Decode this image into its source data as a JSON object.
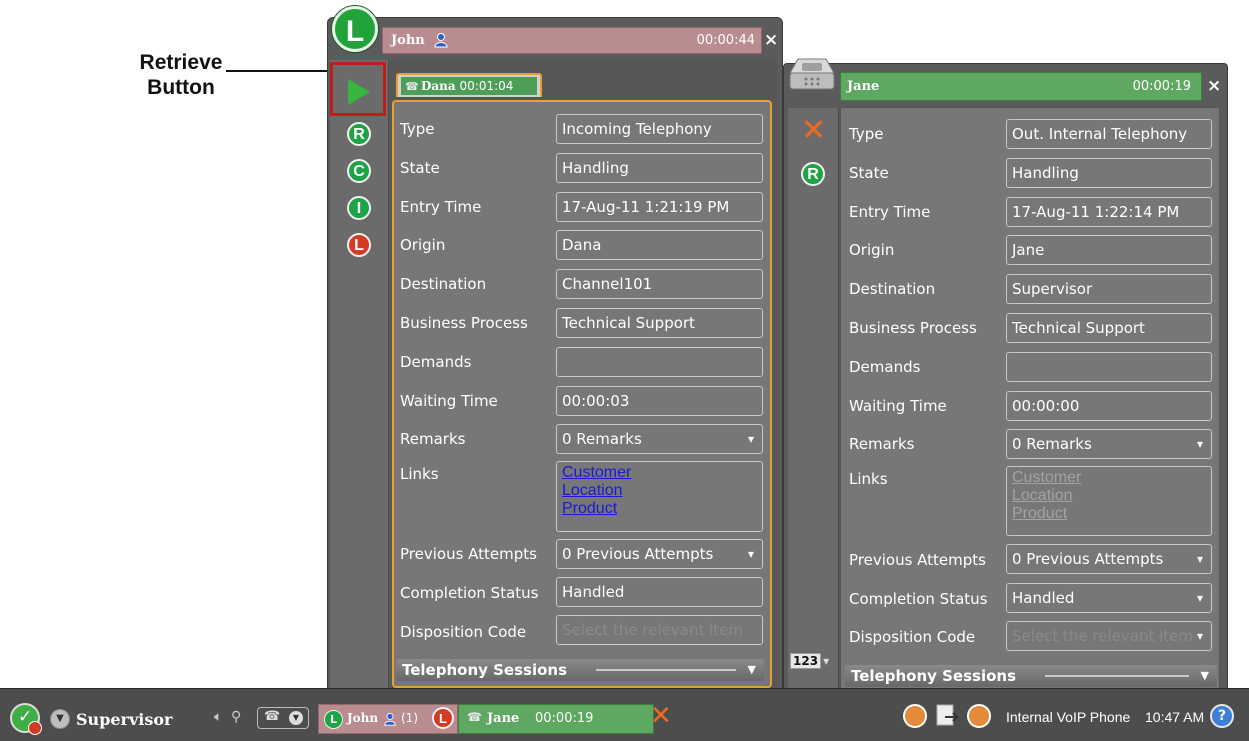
{
  "annotation": {
    "line1": "Retrieve",
    "line2": "Button"
  },
  "left_window": {
    "title": "John",
    "time": "00:00:44",
    "close": "×",
    "status_letter": "L",
    "tab": {
      "name": "Dana",
      "time": "00:01:04"
    },
    "side_buttons": [
      "R",
      "C",
      "I",
      "L"
    ],
    "fields": [
      {
        "label": "Type",
        "value": "Incoming Telephony"
      },
      {
        "label": "State",
        "value": "Handling"
      },
      {
        "label": "Entry Time",
        "value": "17-Aug-11 1:21:19 PM"
      },
      {
        "label": "Origin",
        "value": "Dana"
      },
      {
        "label": "Destination",
        "value": "Channel101"
      },
      {
        "label": "Business Process",
        "value": "Technical Support"
      },
      {
        "label": "Demands",
        "value": ""
      },
      {
        "label": "Waiting Time",
        "value": "00:00:03"
      },
      {
        "label": "Remarks",
        "value": "0 Remarks"
      }
    ],
    "links_label": "Links",
    "links": [
      "Customer",
      "Location",
      "Product"
    ],
    "prev_attempts": {
      "label": "Previous Attempts",
      "value": "0 Previous Attempts"
    },
    "completion": {
      "label": "Completion Status",
      "value": "Handled"
    },
    "disposition": {
      "label": "Disposition Code",
      "placeholder": "Select the relevant item"
    },
    "sessions": "Telephony Sessions"
  },
  "right_window": {
    "title": "Jane",
    "time": "00:00:19",
    "close": "×",
    "side_buttons": [
      "R"
    ],
    "counter": "123",
    "fields": [
      {
        "label": "Type",
        "value": "Out. Internal Telephony"
      },
      {
        "label": "State",
        "value": "Handling"
      },
      {
        "label": "Entry Time",
        "value": "17-Aug-11 1:22:14 PM"
      },
      {
        "label": "Origin",
        "value": "Jane"
      },
      {
        "label": "Destination",
        "value": "Supervisor"
      },
      {
        "label": "Business Process",
        "value": "Technical Support"
      },
      {
        "label": "Demands",
        "value": ""
      },
      {
        "label": "Waiting Time",
        "value": "00:00:00"
      },
      {
        "label": "Remarks",
        "value": "0 Remarks"
      }
    ],
    "links_label": "Links",
    "links": [
      "Customer",
      "Location",
      "Product"
    ],
    "prev_attempts": {
      "label": "Previous Attempts",
      "value": "0 Previous Attempts"
    },
    "completion": {
      "label": "Completion Status",
      "value": "Handled"
    },
    "disposition": {
      "label": "Disposition Code",
      "placeholder": "Select the relevant item"
    },
    "sessions": "Telephony Sessions"
  },
  "taskbar": {
    "user": "Supervisor",
    "john_item": {
      "name": "John",
      "count": "(1)"
    },
    "jane_item": {
      "name": "Jane",
      "time": "00:00:19"
    },
    "phone_label": "Internal VoIP Phone",
    "clock": "10:47 AM",
    "help": "?"
  },
  "colors": {
    "accent_orange": "#e8a032",
    "green_button": "#1ea446",
    "red_button": "#d43b24",
    "retrieve_border": "#c11b1b"
  }
}
